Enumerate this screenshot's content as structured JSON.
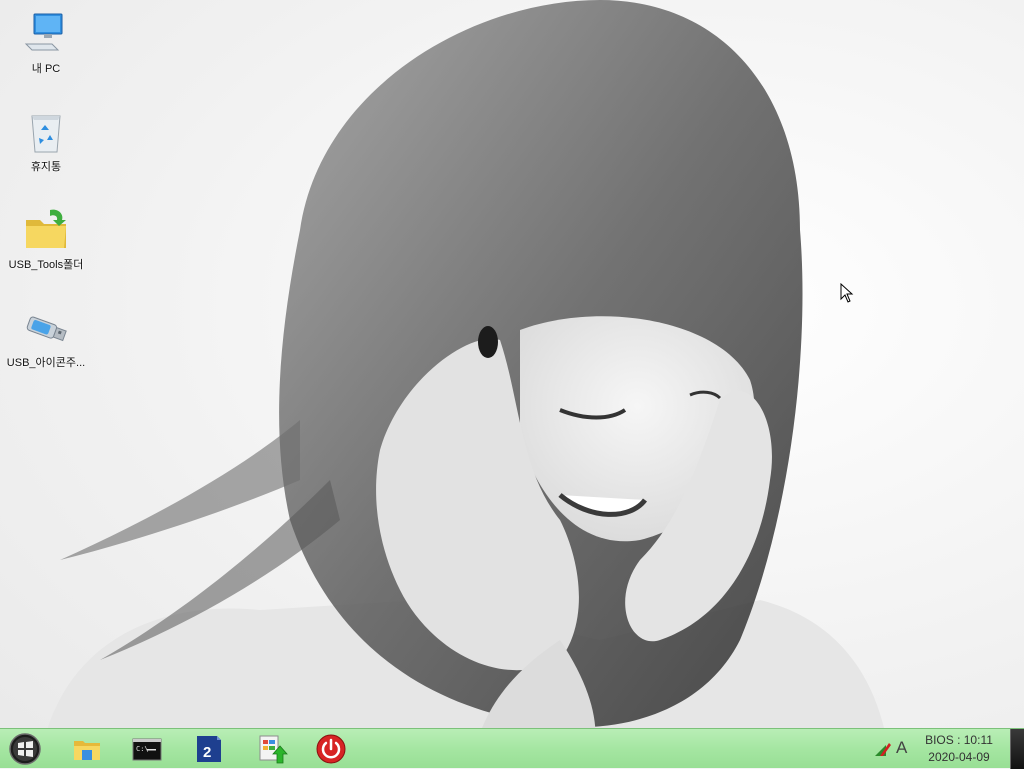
{
  "desktop": {
    "icons": [
      {
        "label": "내 PC",
        "icon": "computer-icon"
      },
      {
        "label": "휴지통",
        "icon": "recycle-bin-icon"
      },
      {
        "label": "USB_Tools폴더",
        "icon": "folder-icon"
      },
      {
        "label": "USB_아이콘주...",
        "icon": "usb-drive-icon"
      }
    ]
  },
  "taskbar": {
    "start": {
      "icon": "windows-logo-icon"
    },
    "pinned": [
      {
        "icon": "file-explorer-icon"
      },
      {
        "icon": "command-prompt-icon"
      },
      {
        "icon": "app-2-icon",
        "text": "2"
      },
      {
        "icon": "installer-icon"
      },
      {
        "icon": "power-icon"
      }
    ],
    "tray": {
      "network_icon": "network-icon",
      "ime_label": "A",
      "clock_line1": "BIOS : 10:11",
      "clock_line2": "2020-04-09"
    }
  },
  "colors": {
    "taskbar_top": "#b9eeb6",
    "taskbar_bottom": "#98df95"
  }
}
